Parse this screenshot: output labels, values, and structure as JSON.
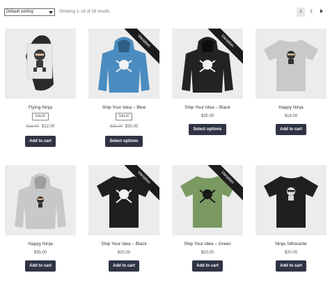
{
  "toolbar": {
    "sort_selected": "Default sorting",
    "result_count": "Showing 1–16 of 26 results",
    "pages": [
      "1",
      "2"
    ]
  },
  "products": [
    {
      "title": "Flying Ninja",
      "sale": "SALE!",
      "old_price": "$15.00",
      "price": "$12.00",
      "button": "Add to cart"
    },
    {
      "title": "Ship Your Idea – Blue",
      "ribbon": "Variation",
      "sale": "SALE!",
      "old_price": "$35.00",
      "price": "$30.00",
      "button": "Select options"
    },
    {
      "title": "Ship Your Idea – Black",
      "ribbon": "Variation",
      "price": "$35.00",
      "button": "Select options"
    },
    {
      "title": "Happy Ninja",
      "price": "$18.00",
      "button": "Add to cart"
    },
    {
      "title": "Happy Ninja",
      "price": "$35.00",
      "button": "Add to cart"
    },
    {
      "title": "Ship Your Idea – Black",
      "ribbon": "Variation",
      "price": "$20.00",
      "button": "Add to cart"
    },
    {
      "title": "Ship Your Idea – Green",
      "ribbon": "Variation",
      "price": "$20.00",
      "button": "Add to cart"
    },
    {
      "title": "Ninja Silhouette",
      "price": "$20.00",
      "button": "Add to cart"
    }
  ],
  "colors": {
    "button_bg": "#2f3344",
    "hoodie_blue": "#4a8cc0",
    "hoodie_black": "#232323",
    "tee_grey": "#c9c9c9",
    "tee_green": "#7a9a62",
    "tee_black": "#1f1f1f",
    "hoodie_grey": "#c8c8c8"
  }
}
